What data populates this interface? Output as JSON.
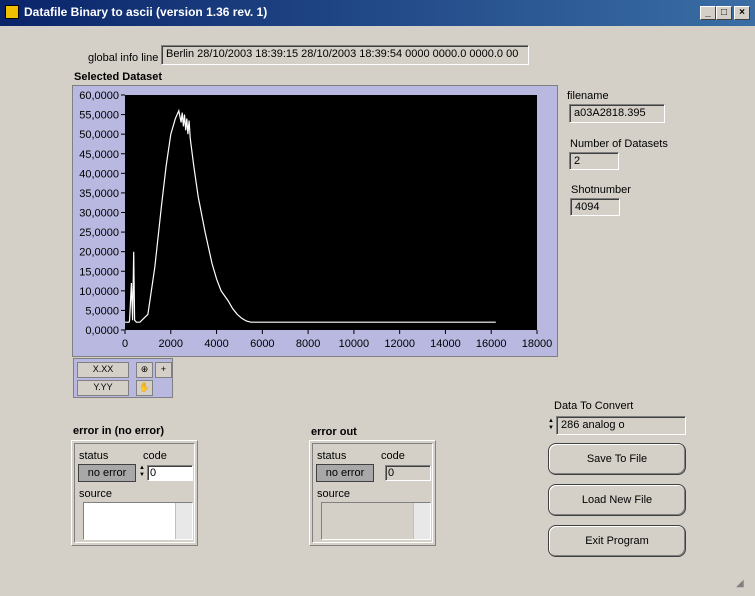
{
  "window": {
    "title": "Datafile Binary to ascii (version 1.36 rev. 1)",
    "min_icon": "minimize-icon",
    "max_icon": "maximize-icon",
    "close_icon": "close-icon"
  },
  "global_info": {
    "label": "global info line",
    "value": "Berlin 28/10/2003 18:39:15 28/10/2003 18:39:54 0000 0000.0 0000.0 00"
  },
  "graph": {
    "label": "Selected Dataset"
  },
  "right_panel": {
    "filename_label": "filename",
    "filename_value": "a03A2818.395",
    "datasets_label": "Number of Datasets",
    "datasets_value": "2",
    "shot_label": "Shotnumber",
    "shot_value": "4094"
  },
  "error_in": {
    "title": "error in (no error)",
    "status_label": "status",
    "code_label": "code",
    "status_value": "no error",
    "code_value": "0",
    "source_label": "source"
  },
  "error_out": {
    "title": "error out",
    "status_label": "status",
    "code_label": "code",
    "status_value": "no error",
    "code_value": "0",
    "source_label": "source"
  },
  "convert": {
    "label": "Data To Convert",
    "value": "286 analog  o"
  },
  "buttons": {
    "save": "Save To File",
    "load": "Load New File",
    "exit": "Exit Program"
  },
  "palette": {
    "x_format": "X.XX",
    "y_format": "Y.YY"
  },
  "chart_data": {
    "type": "line",
    "xlim": [
      0,
      18000
    ],
    "ylim": [
      0,
      60000
    ],
    "x_ticks": [
      0,
      2000,
      4000,
      6000,
      8000,
      10000,
      12000,
      14000,
      16000,
      18000
    ],
    "y_ticks": [
      "0,0000",
      "5,0000",
      "10,0000",
      "15,0000",
      "20,0000",
      "25,0000",
      "30,0000",
      "35,0000",
      "40,0000",
      "45,0000",
      "50,0000",
      "55,0000",
      "60,0000"
    ],
    "y_values": [
      0,
      5000,
      10000,
      15000,
      20000,
      25000,
      30000,
      35000,
      40000,
      45000,
      50000,
      55000,
      60000
    ],
    "plot_bg": "#000000",
    "line_color": "#ffffff",
    "grid": false,
    "series": [
      {
        "x": [
          0,
          180,
          200,
          280,
          330,
          380,
          420,
          500,
          550,
          650,
          1000,
          1300,
          1600,
          1800,
          2000,
          2200,
          2350,
          2450,
          2500,
          2550,
          2600,
          2650,
          2700,
          2750,
          2800,
          2850,
          3000,
          3200,
          3500,
          3800,
          4000,
          4200,
          4500,
          4700,
          4900,
          5100,
          5300,
          5500,
          6000,
          8000,
          10000,
          12000,
          14000,
          16200
        ],
        "y": [
          2000,
          2000,
          2500,
          12000,
          2500,
          20000,
          2500,
          2000,
          2000,
          2000,
          4000,
          16000,
          32000,
          42000,
          50000,
          54000,
          56000,
          53000,
          55500,
          52000,
          55000,
          51000,
          54000,
          50000,
          53500,
          49000,
          42000,
          34000,
          25000,
          17000,
          13000,
          10000,
          7500,
          5500,
          4000,
          3000,
          2300,
          2000,
          2000,
          2000,
          2000,
          2000,
          2000,
          2000
        ]
      }
    ]
  }
}
